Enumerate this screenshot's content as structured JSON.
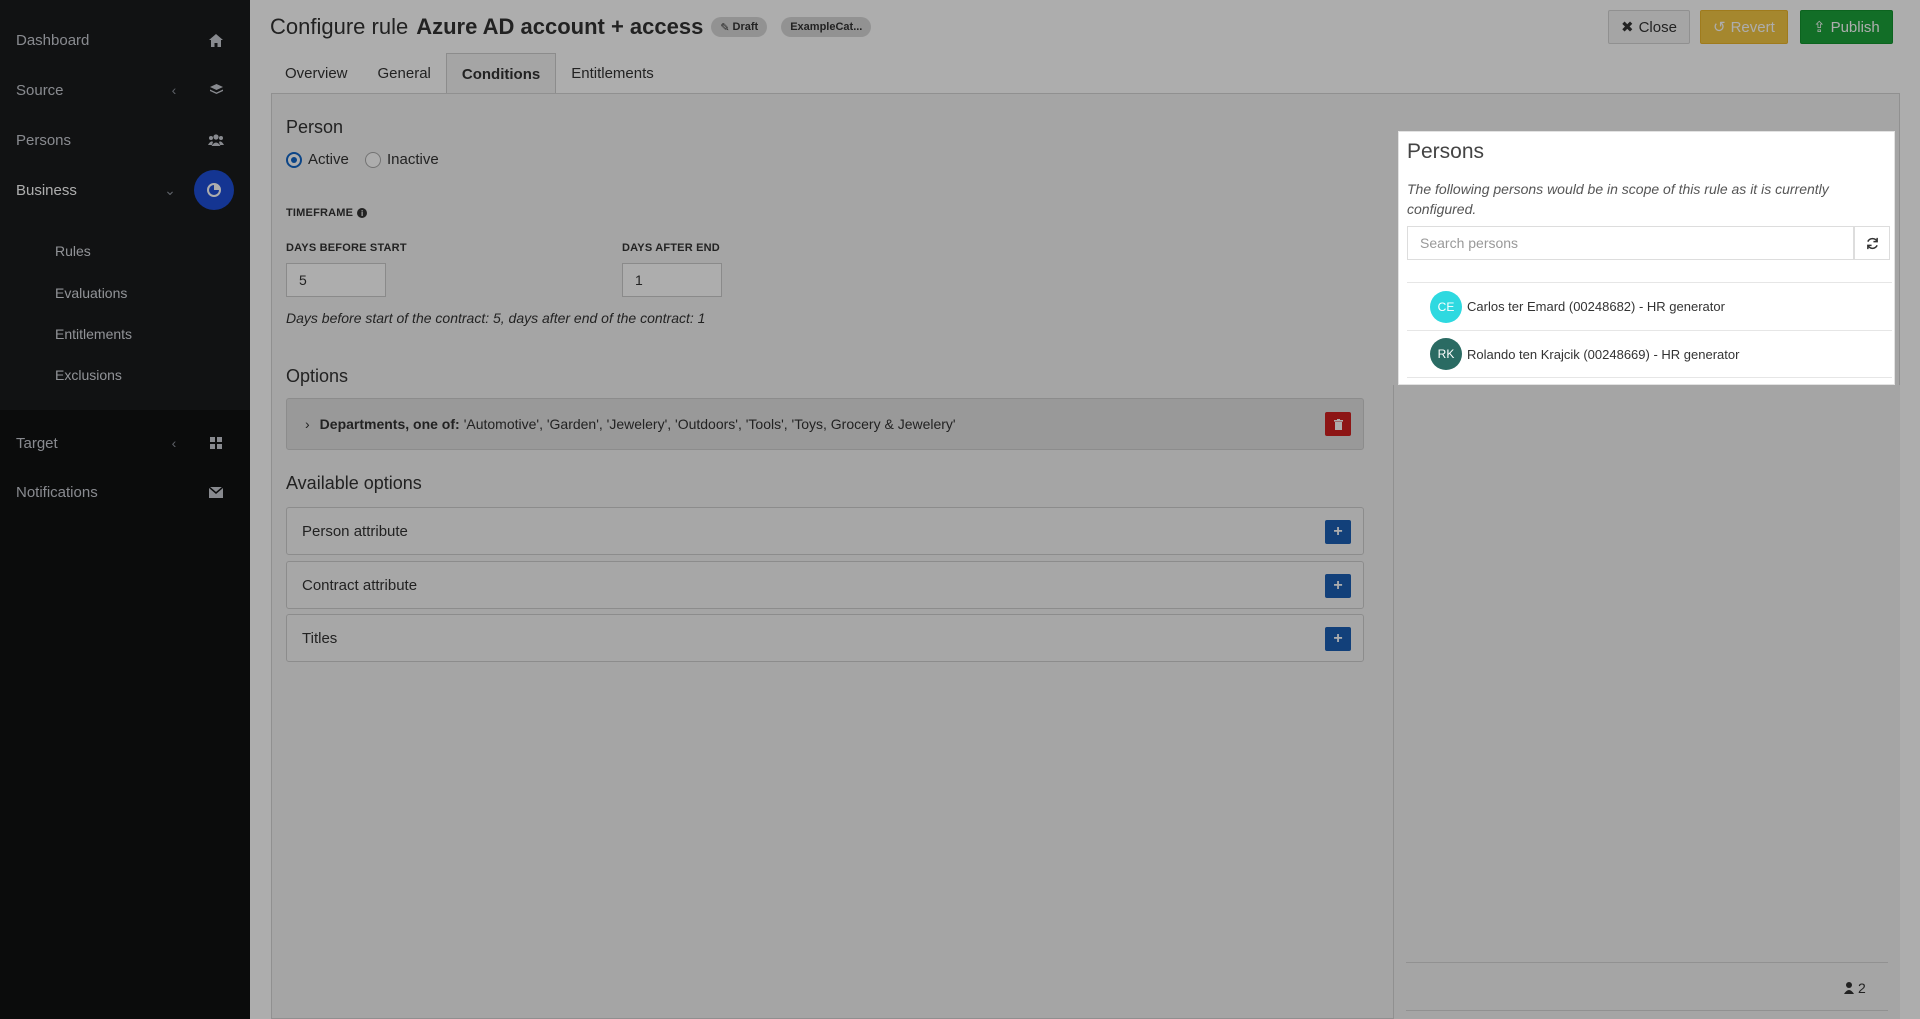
{
  "sidebar": {
    "items": [
      {
        "label": "Dashboard",
        "icon": "home-icon"
      },
      {
        "label": "Source",
        "icon": "database-icon"
      },
      {
        "label": "Persons",
        "icon": "users-icon"
      },
      {
        "label": "Business",
        "icon": "briefcase-icon"
      },
      {
        "label": "Target",
        "icon": "grid-icon"
      },
      {
        "label": "Notifications",
        "icon": "envelope-icon"
      }
    ],
    "business_sub": [
      "Rules",
      "Evaluations",
      "Entitlements",
      "Exclusions"
    ]
  },
  "header": {
    "prefix": "Configure rule",
    "rule_name": "Azure AD account + access",
    "status_badge": "Draft",
    "category_badge": "ExampleCat..."
  },
  "toolbar": {
    "close_label": "Close",
    "revert_label": "Revert",
    "publish_label": "Publish"
  },
  "tabs": [
    "Overview",
    "General",
    "Conditions",
    "Entitlements"
  ],
  "conditions": {
    "person_heading": "Person",
    "active_label": "Active",
    "inactive_label": "Inactive",
    "timeframe_label": "TIMEFRAME",
    "days_before_label": "DAYS BEFORE START",
    "days_before_value": "5",
    "days_after_label": "DAYS AFTER END",
    "days_after_value": "1",
    "summary": "Days before start of the contract: 5, days after end of the contract: 1",
    "options_heading": "Options",
    "department_label": "Departments, one of:",
    "department_values": "'Automotive', 'Garden', 'Jewelery', 'Outdoors', 'Tools', 'Toys, Grocery & Jewelery'",
    "available_heading": "Available options",
    "available": [
      "Person attribute",
      "Contract attribute",
      "Titles"
    ]
  },
  "persons_panel": {
    "title": "Persons",
    "description": "The following persons would be in scope of this rule as it is currently configured.",
    "search_placeholder": "Search persons",
    "people": [
      {
        "initials": "CE",
        "name": "Carlos ter Emard (00248682) - HR generator",
        "color": "#2ed9e0"
      },
      {
        "initials": "RK",
        "name": "Rolando ten Krajcik (00248669) - HR generator",
        "color": "#2a6b63"
      }
    ],
    "count": "2"
  },
  "colors": {
    "primary": "#1b5fb4",
    "revert": "#f3c744",
    "publish": "#1ba33a",
    "delete": "#d01f1f"
  }
}
